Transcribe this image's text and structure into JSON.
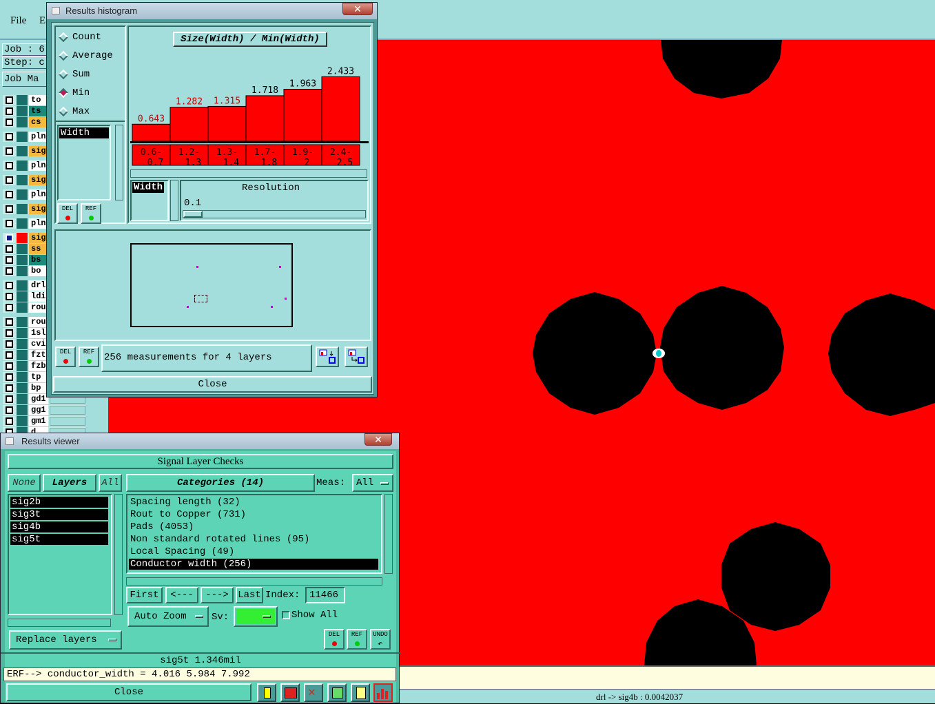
{
  "app": {
    "menu": {
      "file": "File",
      "edit": "E"
    },
    "job_label": "Job : 6",
    "step_label": "Step: c",
    "job_manager_button": "Job Ma",
    "layers": [
      "to",
      "ts",
      "cs",
      "pln",
      "sig",
      "pln",
      "sig",
      "pln",
      "sig",
      "pln",
      "sig",
      "ss",
      "bs",
      "bo",
      "drl",
      "ldi",
      "rou",
      "rou",
      "1sl",
      "cvi",
      "fzt",
      "fzb",
      "tp",
      "bp",
      "gd1",
      "gg1",
      "gm1",
      "d"
    ],
    "coord_readout": "drl -> sig4b : 0.0042037"
  },
  "histogram_window": {
    "title": "Results histogram",
    "close_symbol": "✕",
    "modes": [
      {
        "label": "Count",
        "selected": false
      },
      {
        "label": "Average",
        "selected": false
      },
      {
        "label": "Sum",
        "selected": false
      },
      {
        "label": "Min",
        "selected": true
      },
      {
        "label": "Max",
        "selected": false
      }
    ],
    "attr_list_item": "Width",
    "chart_title": "Size(Width) / Min(Width)",
    "resolution_attr": "Width",
    "resolution_label": "Resolution",
    "resolution_value": "0.1",
    "measurements_text": "256 measurements for 4 layers",
    "del_label": "DEL",
    "ref_label": "REF",
    "close_label": "Close"
  },
  "chart_data": {
    "type": "bar",
    "title": "Size(Width) / Min(Width)",
    "categories": [
      "0.6-\n0.7",
      "1.2-\n1.3",
      "1.3-\n1.4",
      "1.7-\n1.8",
      "1.9-\n2",
      "2.4-\n2.5"
    ],
    "category_lines": [
      [
        "0.6-",
        "0.7"
      ],
      [
        "1.2-",
        "1.3"
      ],
      [
        "1.3-",
        "1.4"
      ],
      [
        "1.7-",
        "1.8"
      ],
      [
        "1.9-",
        "2"
      ],
      [
        "2.4-",
        "2.5"
      ]
    ],
    "values": [
      0.643,
      1.282,
      1.315,
      1.718,
      1.963,
      2.433
    ],
    "value_labels": [
      "0.643",
      "1.282",
      "1.315",
      "1.718",
      "1.963",
      "2.433"
    ],
    "label_colors": [
      "#d00000",
      "#d00000",
      "#d00000",
      "#000000",
      "#000000",
      "#000000"
    ],
    "bar_color": "#ff0000",
    "ylim": [
      0,
      2.6
    ]
  },
  "results_viewer": {
    "title": "Results viewer",
    "close_symbol": "✕",
    "header": "Signal Layer Checks",
    "none_button": "None",
    "layers_button": "Layers",
    "all_button": "All",
    "layers": [
      "sig2b",
      "sig3t",
      "sig4b",
      "sig5t"
    ],
    "categories_header": "Categories (14)",
    "meas_label": "Meas:",
    "meas_value": "All",
    "categories": [
      "Spacing length (32)",
      "Rout to Copper (731)",
      "Pads (4053)",
      "Non standard rotated lines (95)",
      "Local Spacing (49)",
      "Conductor width (256)"
    ],
    "selected_category": 5,
    "first_button": "First",
    "prev_button": "<---",
    "next_button": "--->",
    "last_button": "Last",
    "index_label": "Index:",
    "index_value": "11466",
    "auto_zoom": "Auto Zoom",
    "sv_label": "Sv:",
    "sv_color": "#33ee33",
    "show_all": "Show All",
    "replace_layers": "Replace layers",
    "del_label": "DEL",
    "ref_label": "REF",
    "undo_label": "UNDO",
    "status_line": "sig5t 1.346mil",
    "erf_line": "ERF--> conductor_width = 4.016 5.984 7.992",
    "close_label": "Close"
  }
}
